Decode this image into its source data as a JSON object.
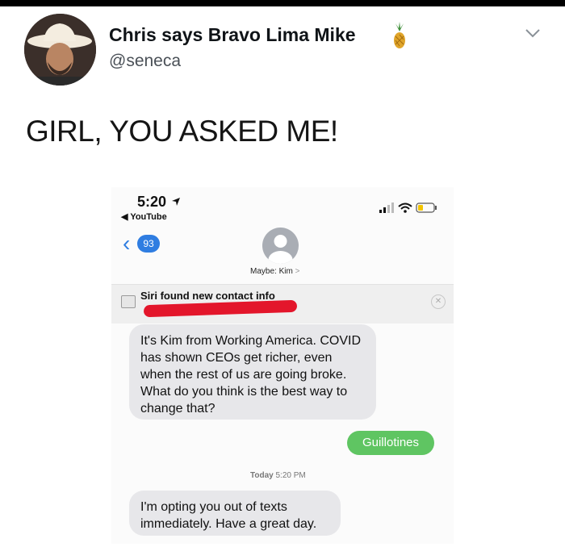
{
  "tweet": {
    "display_name": "Chris says Bravo Lima Mike",
    "handle": "@seneca",
    "text": "GIRL, YOU ASKED ME!",
    "name_emoji": "pineapple-icon",
    "menu_icon": "chevron-down-icon"
  },
  "phone": {
    "status_time": "5:20",
    "back_app": "◀ YouTube",
    "unread_count": "93",
    "contact_name": "Maybe: Kim",
    "contact_chevron": ">",
    "siri_text": "Siri found new contact info",
    "messages": [
      {
        "direction": "incoming",
        "text": "It's Kim from Working America. COVID has shown CEOs get richer, even when the rest of us are going broke. What do you think is the best way to change that?"
      },
      {
        "direction": "outgoing",
        "text": "Guillotines"
      },
      {
        "direction": "incoming",
        "text": "I'm opting you out of texts immediately. Have a great day."
      }
    ],
    "timestamp_day": "Today",
    "timestamp_time": "5:20 PM"
  },
  "colors": {
    "imessage_blue": "#2f7de1",
    "sms_green": "#5fc562",
    "incoming_bubble": "#e7e7ea",
    "redaction_red": "#e3162b"
  }
}
